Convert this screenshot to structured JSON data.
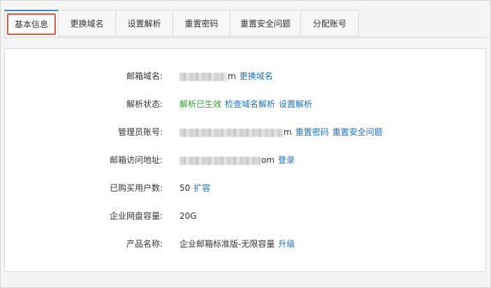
{
  "tabs": [
    {
      "label": "基本信息",
      "active": true
    },
    {
      "label": "更换域名",
      "active": false
    },
    {
      "label": "设置解析",
      "active": false
    },
    {
      "label": "重置密码",
      "active": false
    },
    {
      "label": "重置安全问题",
      "active": false
    },
    {
      "label": "分配账号",
      "active": false
    }
  ],
  "info": {
    "domain": {
      "label": "邮箱域名:",
      "suffix": "m",
      "link": "更换域名"
    },
    "dns": {
      "label": "解析状态:",
      "status": "解析已生效",
      "link1": "检查域名解析",
      "link2": "设置解析"
    },
    "admin": {
      "label": "管理员账号:",
      "suffix": "m",
      "link1": "重置密码",
      "link2": "重置安全问题"
    },
    "access": {
      "label": "邮箱访问地址:",
      "suffix": "om",
      "link": "登录"
    },
    "users": {
      "label": "已购买用户数:",
      "value": "50",
      "link": "扩容"
    },
    "storage": {
      "label": "企业网盘容量:",
      "value": "20G"
    },
    "product": {
      "label": "产品名称:",
      "value": "企业邮箱标准版-无限容量",
      "link": "升级"
    }
  },
  "colors": {
    "accent": "#2a8fd4",
    "highlight": "#e8543c",
    "link": "#1a73c9",
    "success": "#2aa52a"
  }
}
